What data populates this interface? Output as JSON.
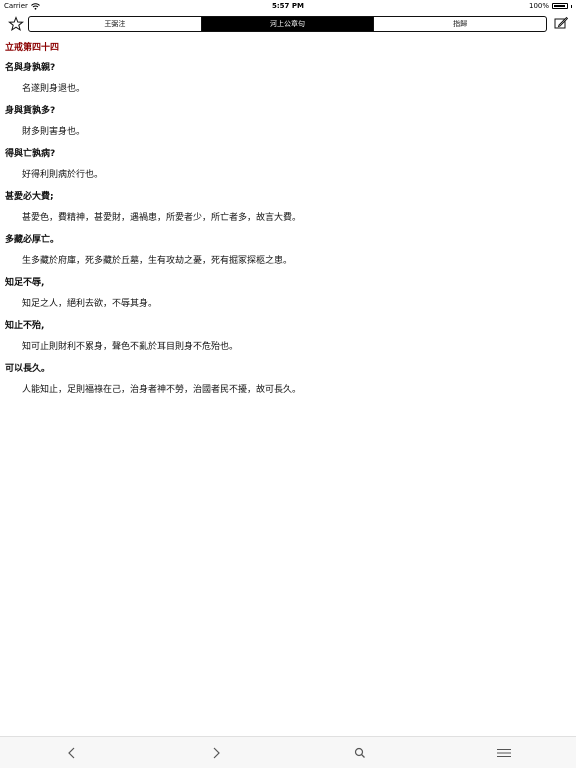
{
  "status": {
    "carrier": "Carrier",
    "time": "5:57 PM",
    "battery": "100%"
  },
  "tabs": [
    {
      "label": "王弼注",
      "active": false
    },
    {
      "label": "河上公章句",
      "active": true
    },
    {
      "label": "指歸",
      "active": false
    }
  ],
  "chapter_title": "立戒第四十四",
  "passages": [
    {
      "q": "名與身孰親?",
      "a": "名遂則身退也。"
    },
    {
      "q": "身與貨孰多?",
      "a": "財多則害身也。"
    },
    {
      "q": "得與亡孰病?",
      "a": "好得利則病於行也。"
    },
    {
      "q": "甚愛必大費;",
      "a": "甚愛色，費精神，甚愛財，遇禍患，所愛者少，所亡者多，故言大費。"
    },
    {
      "q": "多藏必厚亡。",
      "a": "生多藏於府庫，死多藏於丘墓，生有攻劫之憂，死有掘冢探柩之患。"
    },
    {
      "q": "知足不辱,",
      "a": "知足之人，絕利去欲，不辱其身。"
    },
    {
      "q": "知止不殆,",
      "a": "知可止則財利不累身，聲色不亂於耳目則身不危殆也。"
    },
    {
      "q": "可以長久。",
      "a": "人能知止，足則福祿在己，治身者神不勞，治國者民不擾，故可長久。"
    }
  ],
  "icons": {
    "wifi": "wifi-icon",
    "star": "star-icon",
    "edit": "edit-icon",
    "back": "chevron-left-icon",
    "forward": "chevron-right-icon",
    "search": "search-icon",
    "menu": "menu-icon"
  },
  "colors": {
    "chapter_title": "#8b0000",
    "active_tab_bg": "#000000"
  }
}
